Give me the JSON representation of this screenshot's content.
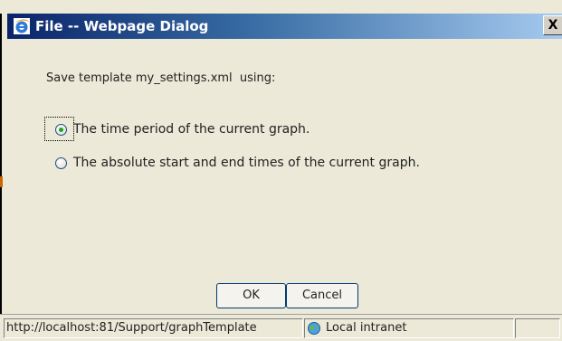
{
  "window": {
    "title": "File -- Webpage Dialog",
    "close_glyph": "X"
  },
  "dialog": {
    "prompt": "Save template my_settings.xml  using:",
    "options": [
      {
        "label": "The time period of the current graph.",
        "checked": true
      },
      {
        "label": "The absolute start and end times of the current graph.",
        "checked": false
      }
    ],
    "ok_label": "OK",
    "cancel_label": "Cancel"
  },
  "statusbar": {
    "url": "http://localhost:81/Support/graphTemplate",
    "zone": "Local intranet"
  },
  "icons": {
    "title_icon": "ie-icon",
    "zone_icon": "intranet-globe-icon"
  },
  "colors": {
    "titlebar_start": "#0a246a",
    "titlebar_end": "#a6caf0",
    "dialog_bg": "#ece9d8",
    "radio_dot": "#21a121"
  }
}
